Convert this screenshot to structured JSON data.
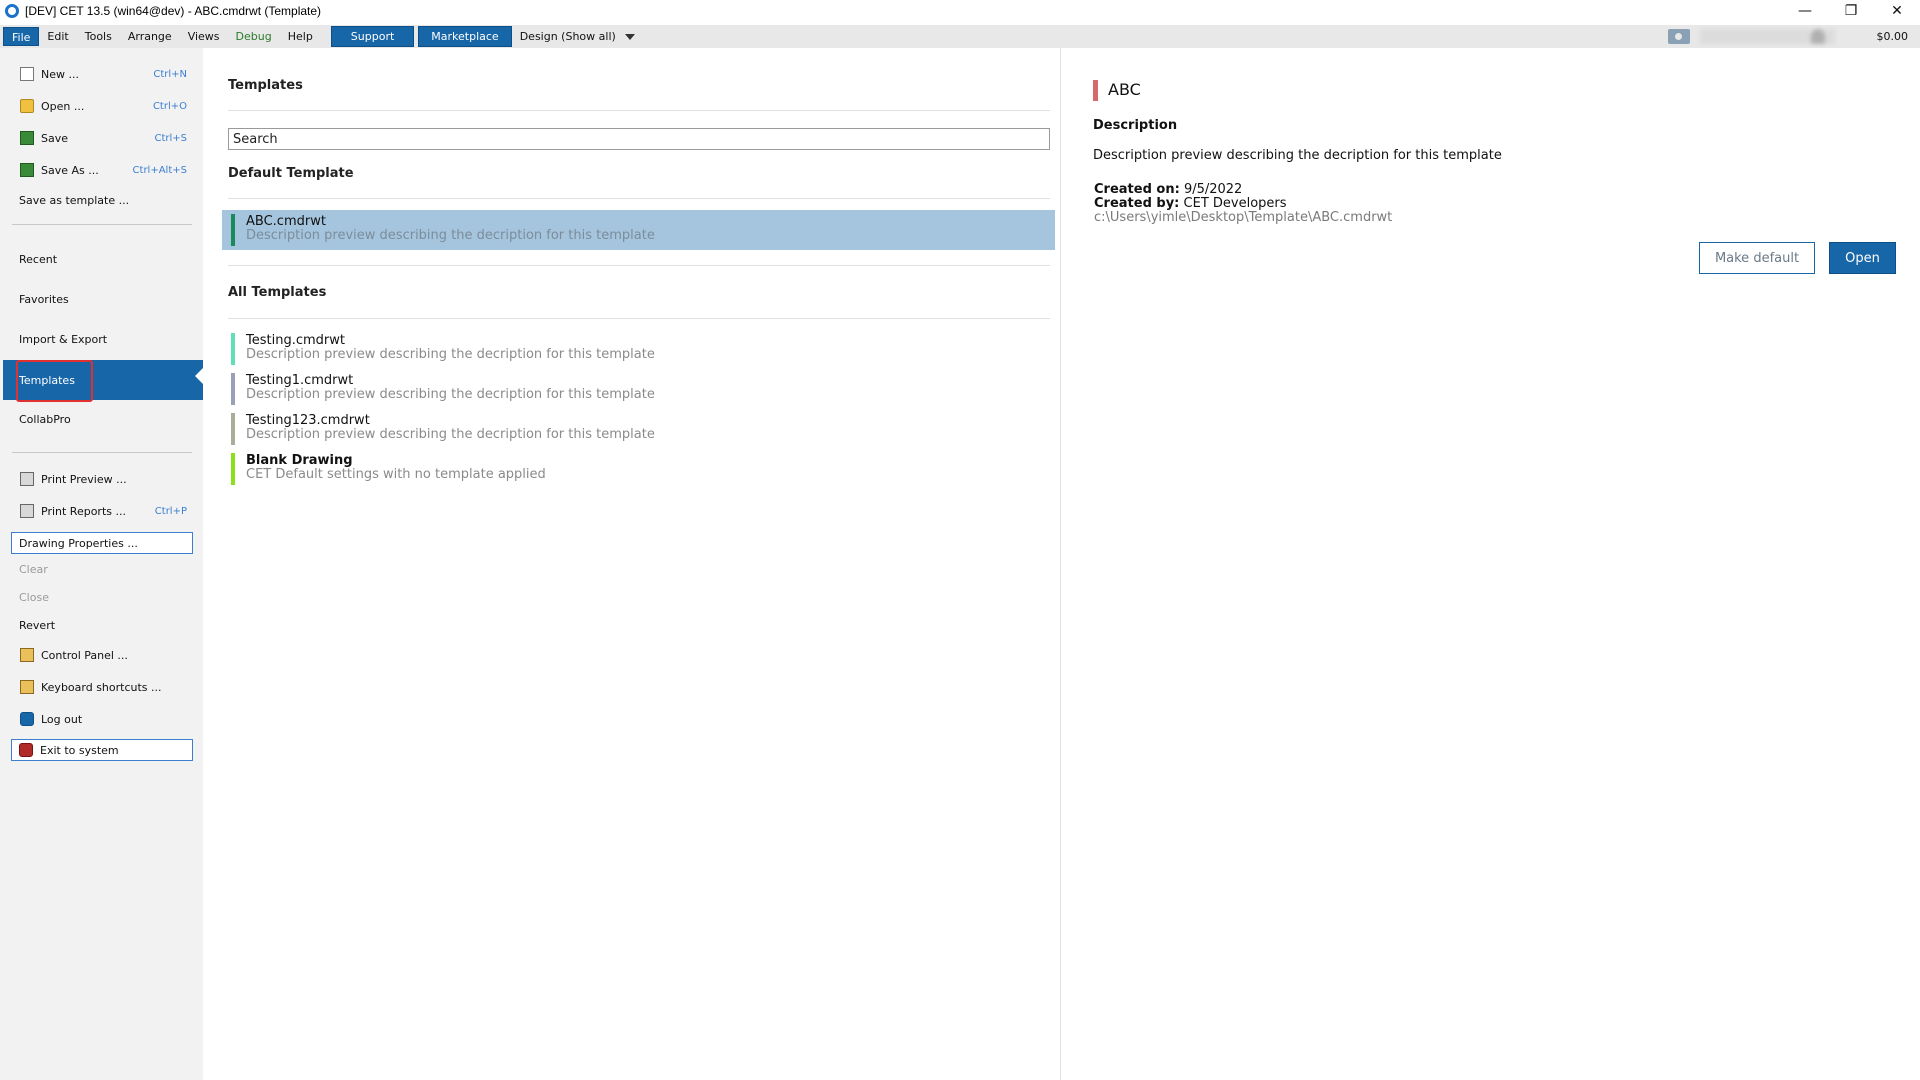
{
  "window": {
    "title": "[DEV] CET 13.5 (win64@dev) - ABC.cmdrwt (Template)",
    "controls": {
      "minimize": "—",
      "restore": "❐",
      "close": "✕"
    }
  },
  "menubar": {
    "items": [
      "File",
      "Edit",
      "Tools",
      "Arrange",
      "Views",
      "Debug",
      "Help"
    ],
    "support_label": "Support",
    "marketplace_label": "Marketplace",
    "design_label": "Design (Show all)",
    "balance": "$0.00"
  },
  "sidebar": {
    "new": {
      "label": "New ...",
      "shortcut": "Ctrl+N"
    },
    "open": {
      "label": "Open ...",
      "shortcut": "Ctrl+O"
    },
    "save": {
      "label": "Save",
      "shortcut": "Ctrl+S"
    },
    "save_as": {
      "label": "Save As ...",
      "shortcut": "Ctrl+Alt+S"
    },
    "save_as_template": "Save as template ...",
    "recent": "Recent",
    "favorites": "Favorites",
    "import_export": "Import & Export",
    "templates": "Templates",
    "collabpro": "CollabPro",
    "print_preview": "Print Preview ...",
    "print_reports": {
      "label": "Print Reports ...",
      "shortcut": "Ctrl+P"
    },
    "drawing_properties": "Drawing Properties ...",
    "clear": "Clear",
    "close": "Close",
    "revert": "Revert",
    "control_panel": "Control Panel ...",
    "keyboard_shortcuts": "Keyboard shortcuts ...",
    "log_out": "Log out",
    "exit": "Exit to system"
  },
  "templates_panel": {
    "title": "Templates",
    "search_value": "Search",
    "default_heading": "Default Template",
    "all_heading": "All Templates",
    "default_template": {
      "name": "ABC.cmdrwt",
      "description": "Description preview describing the decription for this template",
      "color": "#1a8a5a"
    },
    "all_templates": [
      {
        "name": "Testing.cmdrwt",
        "description": "Description preview describing the decription for this template",
        "color": "#5fe0b8"
      },
      {
        "name": "Testing1.cmdrwt",
        "description": "Description preview describing the decription for this template",
        "color": "#9aa0b8"
      },
      {
        "name": "Testing123.cmdrwt",
        "description": "Description preview describing the decription for this template",
        "color": "#a8ae98"
      },
      {
        "name": "Blank Drawing",
        "description": "CET Default settings with no template applied",
        "color": "#8ae01a"
      }
    ]
  },
  "details": {
    "title": "ABC",
    "description_heading": "Description",
    "description": "Description preview describing the decription for this template",
    "created_on_label": "Created on:",
    "created_on": "9/5/2022",
    "created_by_label": "Created by:",
    "created_by": "CET Developers",
    "path": "c:\\Users\\yimle\\Desktop\\Template\\ABC.cmdrwt",
    "make_default_label": "Make default",
    "open_label": "Open"
  }
}
